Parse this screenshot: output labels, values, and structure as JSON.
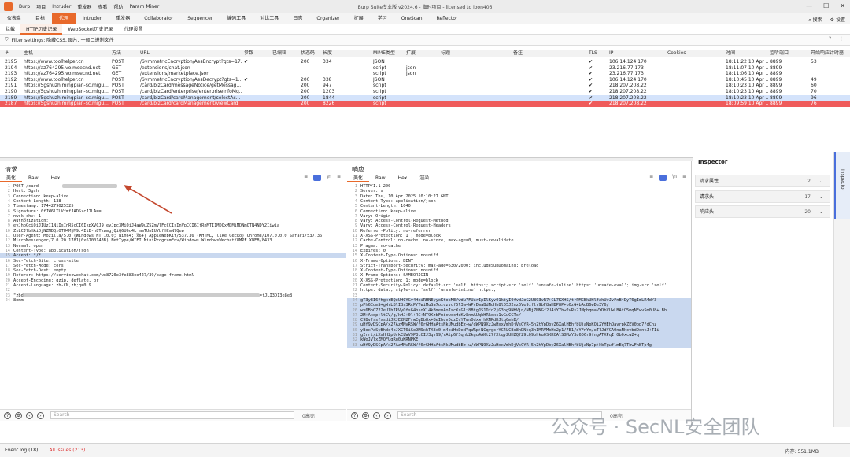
{
  "titlebar": {
    "menus": [
      "Burp",
      "项目",
      "Intruder",
      "重发器",
      "查看",
      "帮助",
      "Param Miner"
    ],
    "title": "Burp Suite专业版  v2024.6 - 临时项目 - licensed to ioon406"
  },
  "tabs1": {
    "items": [
      "仪表盘",
      "目标",
      "代理",
      "Intruder",
      "重发器",
      "Collaborator",
      "Sequencer",
      "编码工具",
      "对比工具",
      "日志",
      "Organizer",
      "扩展",
      "学习",
      "OneScan",
      "Reflector"
    ],
    "active_index": 2,
    "search_label": "搜索",
    "settings_label": "设置"
  },
  "tabs2": {
    "items": [
      "拦截",
      "HTTP历史记录",
      "WebSocket历史记录",
      "代理设置"
    ],
    "active_index": 1
  },
  "filter": {
    "text": "Filter settings: 隐藏CSS, 图片, 一般二进制文件"
  },
  "table": {
    "columns": [
      "#",
      "主机",
      "方法",
      "URL",
      "参数",
      "已编辑",
      "状态码",
      "长度",
      "MIME类型",
      "扩展",
      "标题",
      "备注",
      "TLS",
      "IP",
      "Cookies",
      "时间",
      "监听端口",
      "开始响应计时器"
    ],
    "rows": [
      [
        "2195",
        "https://www.toolhelper.cn",
        "POST",
        "/SymmetricEncryption/AesEncrypt?gts=17...",
        "✔",
        "",
        "200",
        "334",
        "JSON",
        "",
        "",
        "",
        "✔",
        "106.14.124.170",
        "",
        "18:11:22 10 Apr ...",
        "8899",
        "53"
      ],
      [
        "2194",
        "https://az764295.vo.msecnd.net",
        "GET",
        "/extensions/chat.json",
        "",
        "",
        "",
        "",
        "script",
        "json",
        "",
        "",
        "✔",
        "23.216.77.173",
        "",
        "18:11:07 10 Apr ...",
        "8899",
        ""
      ],
      [
        "2193",
        "https://az764295.vo.msecnd.net",
        "GET",
        "/extensions/marketplace.json",
        "",
        "",
        "",
        "",
        "script",
        "json",
        "",
        "",
        "✔",
        "23.216.77.173",
        "",
        "18:11:06 10 Apr ...",
        "8899",
        ""
      ],
      [
        "2192",
        "https://www.toolhelper.cn",
        "POST",
        "/SymmetricEncryption/AesDecrypt?gts=1...",
        "✔",
        "",
        "200",
        "338",
        "JSON",
        "",
        "",
        "",
        "✔",
        "106.14.124.170",
        "",
        "18:10:45 10 Apr ...",
        "8899",
        "49"
      ],
      [
        "2191",
        "https://5gshuzhimingpian-sc.migu...",
        "POST",
        "/card/bizCard/messageNotice/getMessag...",
        "",
        "",
        "200",
        "947",
        "script",
        "",
        "",
        "",
        "✔",
        "218.207.208.22",
        "",
        "18:10:23 10 Apr ...",
        "8899",
        "60"
      ],
      [
        "2190",
        "https://5gshuzhimingpian-sc.migu...",
        "POST",
        "/card/bizCard/enterprise/enterpriseInfoMg...",
        "",
        "",
        "200",
        "1203",
        "script",
        "",
        "",
        "",
        "✔",
        "218.207.208.22",
        "",
        "18:10:23 10 Apr ...",
        "8899",
        "70"
      ],
      [
        "2189",
        "https://5gshuzhimingpian-sc.migu...",
        "POST",
        "/card/bizCard/cardManagement/selectAc...",
        "",
        "",
        "200",
        "1844",
        "script",
        "",
        "",
        "",
        "✔",
        "218.207.208.22",
        "",
        "18:10:23 10 Apr ...",
        "8899",
        "96"
      ],
      [
        "2187",
        "https://5gshuzhimingpian-sc.migu...",
        "POST",
        "/card/bizCard/cardManagement/viewCard",
        "",
        "",
        "200",
        "8226",
        "script",
        "",
        "",
        "",
        "✔",
        "218.207.208.22",
        "",
        "18:09:59 10 Apr ...",
        "8899",
        "76"
      ]
    ]
  },
  "request": {
    "title": "请求",
    "tabs": [
      "美化",
      "Raw",
      "Hex"
    ],
    "lines": [
      "POST /card",
      "Host: 5gsh",
      "Connection: keep-alive",
      "Content-Length: 138",
      "Timestamp: 1744279025325",
      "Signature: 0fJW6lTLVfmfJADSzcJ7LA==",
      "nwsk_chv: 1",
      "Authorization:",
      "eyJhbGciOiJIUzI1NiIsInR5cCI6IkpXVCJ9.eyJpc3MiOiJ4aW9uZ5ZmVlFcCCIsInVpCCI6IjRnMTI1MDQxMDMiMDNmOTN4NDY2Iiwia",
      "ZsLCJlbHAiOjNZMDQzOTU4MjM9.4IiB-n8TzwmgjQiQ6U6q4L_mmTUnEUYbfHCmN7Qew",
      "User-Agent: Mozilla/5.0 (Windows NT 10.0; Win64; x64) AppleWebKit/537.36 (KHTML, like Gecko) Chrome/107.0.0.0 Safari/537.36",
      "MicroMessenger/7.0.20.1781(0x6700143B) NetType/WIFI MiniProgramEnv/Windows WindowsWechat/WMPF XWEB/8433",
      "Normal: open",
      "Content-Type: application/json",
      "Accept: */*",
      "Sec-Fetch-Site: cross-site",
      "Sec-Fetch-Mode: cors",
      "Sec-Fetch-Dest: empty",
      "Referer: https://servicewechat.com/wx8720e3fe883ee427/39/page-frame.html",
      "Accept-Encoding: gzip, deflate, br",
      "Accept-Language: zh-CN,zh;q=0.9",
      "",
      "\"zbd",
      "8nmm"
    ],
    "tail_text": "=jJLI3D13e8e8"
  },
  "response": {
    "title": "响应",
    "tabs": [
      "美化",
      "Raw",
      "Hex",
      "渲染"
    ],
    "lines": [
      "HTTP/1.1 200",
      "Server: s",
      "Date: Thu, 10 Apr 2025 10:10:27 GMT",
      "Content-Type: application/json",
      "Content-Length: 1040",
      "Connection: keep-alive",
      "Vary: Origin",
      "Vary: Access-Control-Request-Method",
      "Vary: Access-Control-Request-Headers",
      "Referrer-Policy: no-referrer",
      "X-XSS-Protection: 1 ; mode=block",
      "Cache-Control: no-cache, no-store, max-age=0, must-revalidate",
      "Pragma: no-cache",
      "Expires: 0",
      "X-Content-Type-Options: nosniff",
      "X-Frame-Options: DENY",
      "Strict-Transport-Security: max-age=63072000; includeSubDomains; preload",
      "X-Content-Type-Options: nosniff",
      "X-Frame-Options: SAMEORIGIN",
      "X-XSS-Protection: 1; mode=block",
      "Content-Security-Policy: default-src 'self' https:; script-src 'self' 'unsafe-inline' https: 'unsafe-eval'; img-src 'self'",
      "https: data:; style-src 'self' 'unsafe-inline' https:;",
      "",
      "gT3y3I6fhgxrEQeUHCYGv4HxiRHNEyyoKtosME/wdu7FUarIpIlKyvO1ktyI9fvdJeG2U893vR7+CL7KXHS/trPMCBkUHlfahUvJvFnB4DyT6gImLR4d/3",
      "pPh6CdmS+gWrLBlIBs3RcPYTwiMuSa7ozczvcf5l3a+WPvDmaBdNdHh8l05J2nz6Ve9iflr9bF8aHBP8P+b0zG+bAoB6wDe3Y6/",
      "wv6BhC722eUlh7RVyOfsG4hsoX14kBmemAoIscXsG1t8BtgJS1Dfd2jG3hg9NHVjn/NNj7MNGf2U4iY7bw2vRs2JMpbqmaVYDbVUwLBAtO5mqNEwvSm0U8+LBh",
      "2M+Axdp+ltCV/g/kHJ+0l+RC+NT9KzbFmicwccHeKv8nmAUqhHRkoxs1vGwCGTs/",
      "C9BvfssfxsdiJKJE2M2FrwCgBb8x+BeIbuvDuzEcYTwnDdxwrhXNPdDJtqGmhB/",
      "uHf9yDSCpA/x27AzMMvRSW/f6rGHHaAtsNkUMudbEz+w/dWPN9XzJwHxxVmhDjVsGYR+5nZtYpDbyZ6XalHBhfbUjaNpKOi2YHEhQavrpkZEV0bp7/dChz",
      "yBoxPaSyBhdq4eJXCT6iGe9M9xhTX8c0+m4oiHxDeNYqWRp+NCqvgcrYC4LCBs8hDNtq3hIMRVMbHc2p1/7E1/dYFnYm/eTlJdYGAOnaNkcvbdOqntJ+TIi",
      "gIrrt/iXsHH2pUrkCLWV9P3cCIJ3qv99/rAlp6fSqhk2kgu4AKt27fXtqyZUHZQf29LQ9phkuOSKKCAlSOMzY3u6O6r9fngATXPqIrOb0xcw2+q",
      "kWoJVlxZMQFUqRq0uKRNPKE",
      "uHf9yDSCpA/x27AzMMvRSW/f6rGHHaAtsNkUMudbEz+w/dWPN9XzJwHxxVmhDjVsGYR+5nZtYpDbyZ6XalHBhfbUjaNp7p+kbTgwflmEq7ThwFhBTp4g"
    ],
    "selected_from": 23
  },
  "bottom": {
    "search_placeholder": "Search",
    "highlight": "0高亮"
  },
  "inspector": {
    "title": "Inspector",
    "sections": [
      {
        "label": "请求属性",
        "count": "2"
      },
      {
        "label": "请求头",
        "count": "17"
      },
      {
        "label": "响应头",
        "count": "20"
      }
    ],
    "rail_label": "Inspector"
  },
  "statusbar": {
    "event_log": "Event log (18)",
    "all_issues": "All issues (213)",
    "memory": "内存: 551.1MB"
  },
  "watermark": "公众号 · SecNL安全团队",
  "colors": {
    "accent": "#e8692b",
    "selected_row": "#d4e3fb",
    "highlight_row": "#ef5b5b"
  }
}
